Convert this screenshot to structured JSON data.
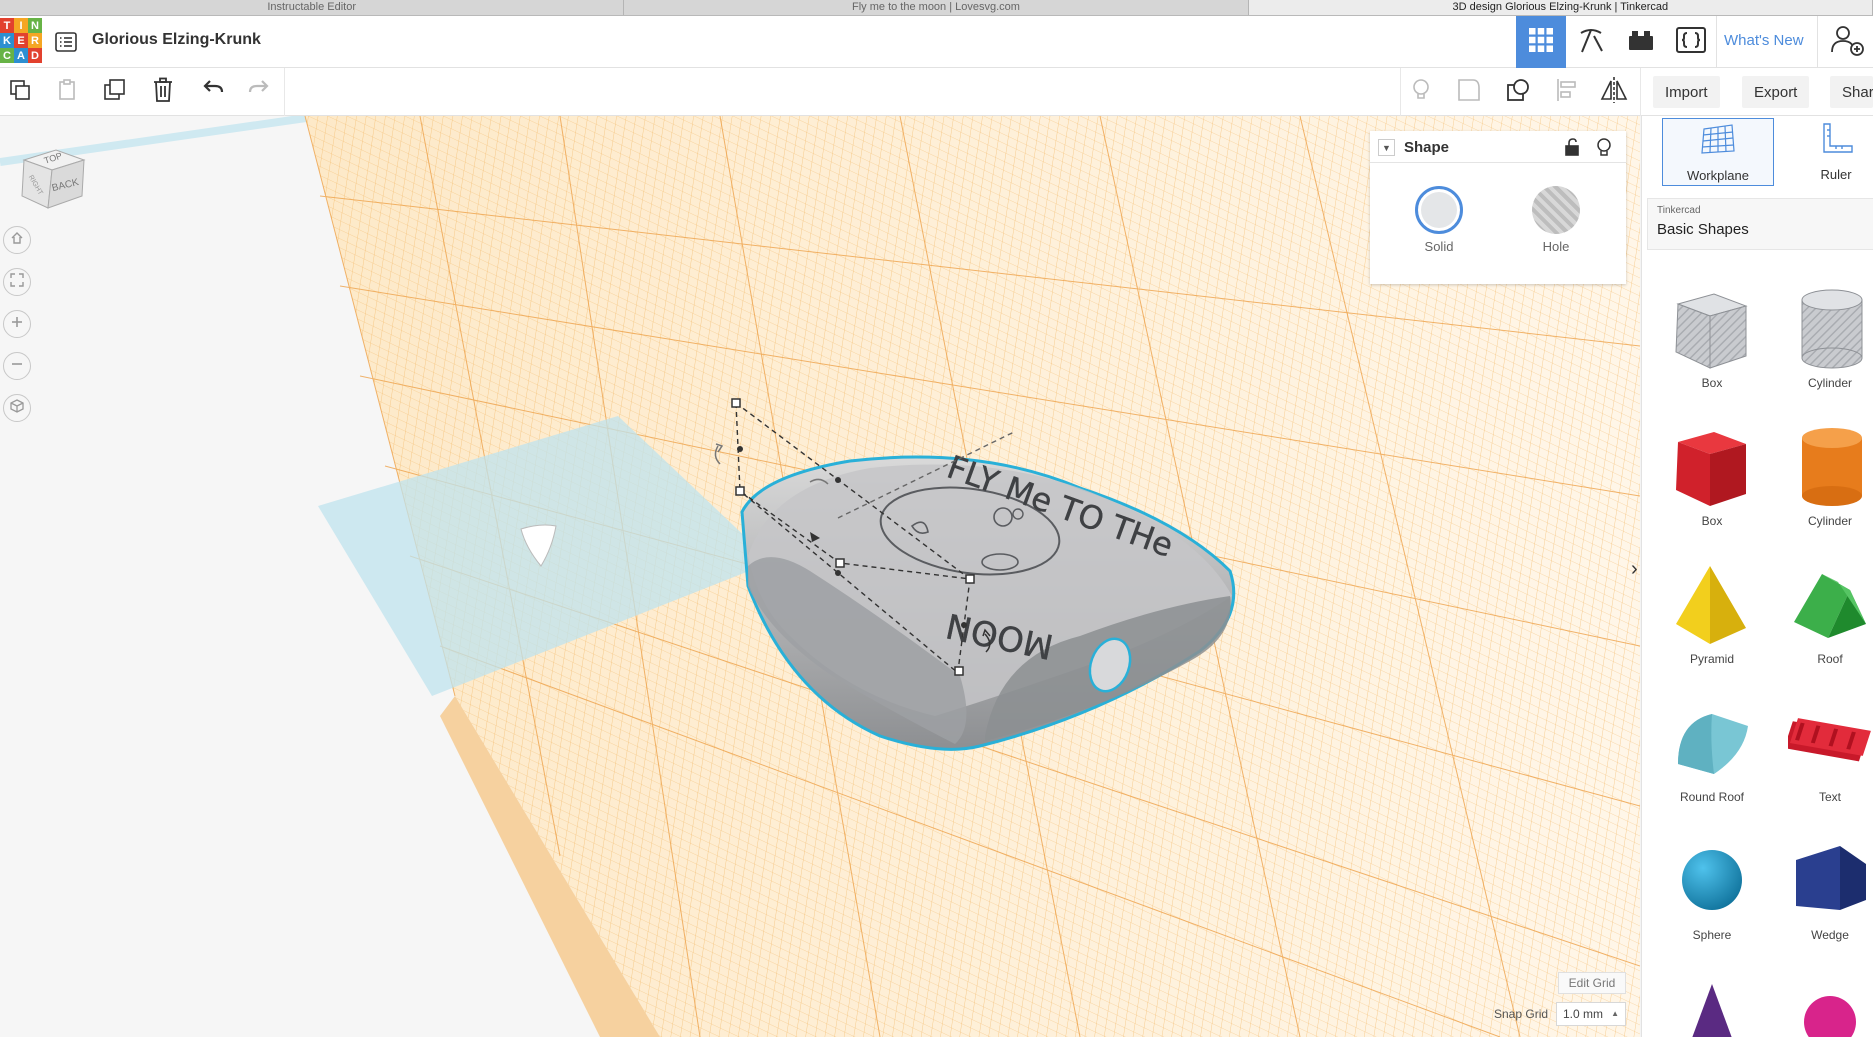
{
  "browser": {
    "tabs": [
      "Instructable Editor",
      "Fly me to the moon | Lovesvg.com",
      "3D design Glorious Elzing-Krunk | Tinkercad"
    ]
  },
  "header": {
    "logo_letters": [
      "T",
      "I",
      "N",
      "K",
      "E",
      "R",
      "C",
      "A",
      "D"
    ],
    "design_title": "Glorious Elzing-Krunk",
    "whats_new": "What's New"
  },
  "toolbar": {
    "import_label": "Import",
    "export_label": "Export",
    "share_label": "Shar"
  },
  "viewcube": {
    "top": "TOP",
    "back": "BACK",
    "left": "RIGHT"
  },
  "model": {
    "text_top": "FLY Me TO THe",
    "text_bottom": "MOON"
  },
  "inspector": {
    "title": "Shape",
    "solid_label": "Solid",
    "hole_label": "Hole"
  },
  "grid": {
    "edit_grid": "Edit Grid",
    "snap_label": "Snap Grid",
    "snap_value": "1.0 mm"
  },
  "panel": {
    "workplane_label": "Workplane",
    "ruler_label": "Ruler",
    "library_source": "Tinkercad",
    "library_name": "Basic Shapes",
    "shapes": [
      {
        "label": "Box"
      },
      {
        "label": "Cylinder"
      },
      {
        "label": "Box"
      },
      {
        "label": "Cylinder"
      },
      {
        "label": "Pyramid"
      },
      {
        "label": "Roof"
      },
      {
        "label": "Round Roof"
      },
      {
        "label": "Text"
      },
      {
        "label": "Sphere"
      },
      {
        "label": "Wedge"
      }
    ]
  },
  "colors": {
    "accent": "#4d8cdc",
    "grid": "#f1a43a",
    "workplane_blue": "#bfe3ee",
    "selection": "#29b0d8"
  }
}
